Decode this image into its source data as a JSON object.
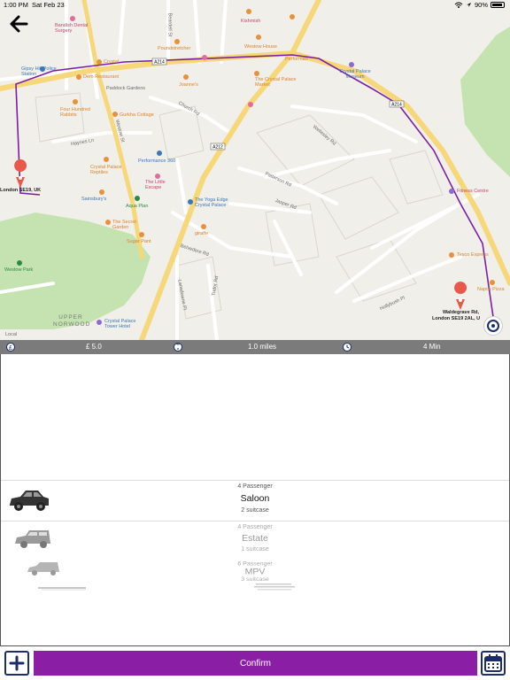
{
  "status_bar": {
    "time": "1:00 PM",
    "date": "Sat Feb 23",
    "battery": "90%",
    "battery_level": 0.9
  },
  "map": {
    "road_badges": [
      "A214",
      "A212",
      "A214"
    ],
    "streets": [
      "Westow St",
      "Church Rd",
      "Paddock Gardens",
      "Wellesley Rd",
      "Belvedere Rd",
      "Beardell St",
      "Jasper Rd",
      "Patterson Rd",
      "Lansdowne Pl",
      "Tudor Rd",
      "Haynes Ln",
      "Hollybush Pl"
    ],
    "pois": {
      "dental": "Bandish Dental Surgery",
      "police": "Gipsy Hill Police Station",
      "crystal": "Crystal",
      "dem": "Dem Restaurant",
      "poundstretcher": "Poundstretcher",
      "kishmish": "Kishmish",
      "westow_house": "Westow House",
      "performance_top": "Performan",
      "museum": "Crystal Palace Museum",
      "joannes": "Joanne's",
      "market": "The Crystal Palace Market",
      "hundred_rabbits": "Four Hundred Rabbits",
      "gurkha": "Gurkha Cottage",
      "performance360": "Performance 360",
      "reptiles": "Crystal Palace Reptiles",
      "little_escape": "The Little Escape",
      "sainsburys": "Sainsbury's",
      "aqua": "Aqua Plan",
      "yoga": "The Yoga Edge Crystal Palace",
      "secret_garden": "The Secret Garden",
      "sugar": "Sugar Pant",
      "giraffe": "giraffe",
      "westow_park": "Westow Park",
      "upper_norwood": "UPPER NORWOOD",
      "hotel": "Crystal Palace Tower Hotel",
      "local": "Local",
      "fitness": "Fitness Centre",
      "tesco": "Tesco Express",
      "napoli": "Napoli Pizza"
    },
    "origin": "London SE19, UK",
    "destination_line1": "Waldegrave Rd,",
    "destination_line2": "London SE19 2AL, U"
  },
  "trip": {
    "price": "£ 5.0",
    "distance": "1.0 miles",
    "duration": "4 Min",
    "icons": [
      "pound-icon",
      "pin-icon",
      "clock-icon"
    ]
  },
  "vehicles": [
    {
      "passengers": "4 Passenger",
      "name": "Saloon",
      "suitcases": "2 suitcase",
      "selected": true
    },
    {
      "passengers": "4 Passenger",
      "name": "Estate",
      "suitcases": "1 suitcase",
      "selected": false
    },
    {
      "passengers": "6 Passenger",
      "name": "MPV",
      "suitcases": "3 suitcase",
      "selected": false
    }
  ],
  "actions": {
    "confirm_label": "Confirm",
    "add_icon": "add-icon",
    "calendar_icon": "calendar-icon"
  },
  "colors": {
    "accent": "#8a1fa6",
    "route": "#7b1fa2",
    "icon_navy": "#1d2c6b",
    "park": "#c4e3b0",
    "info_bar": "#7b7b7b"
  }
}
